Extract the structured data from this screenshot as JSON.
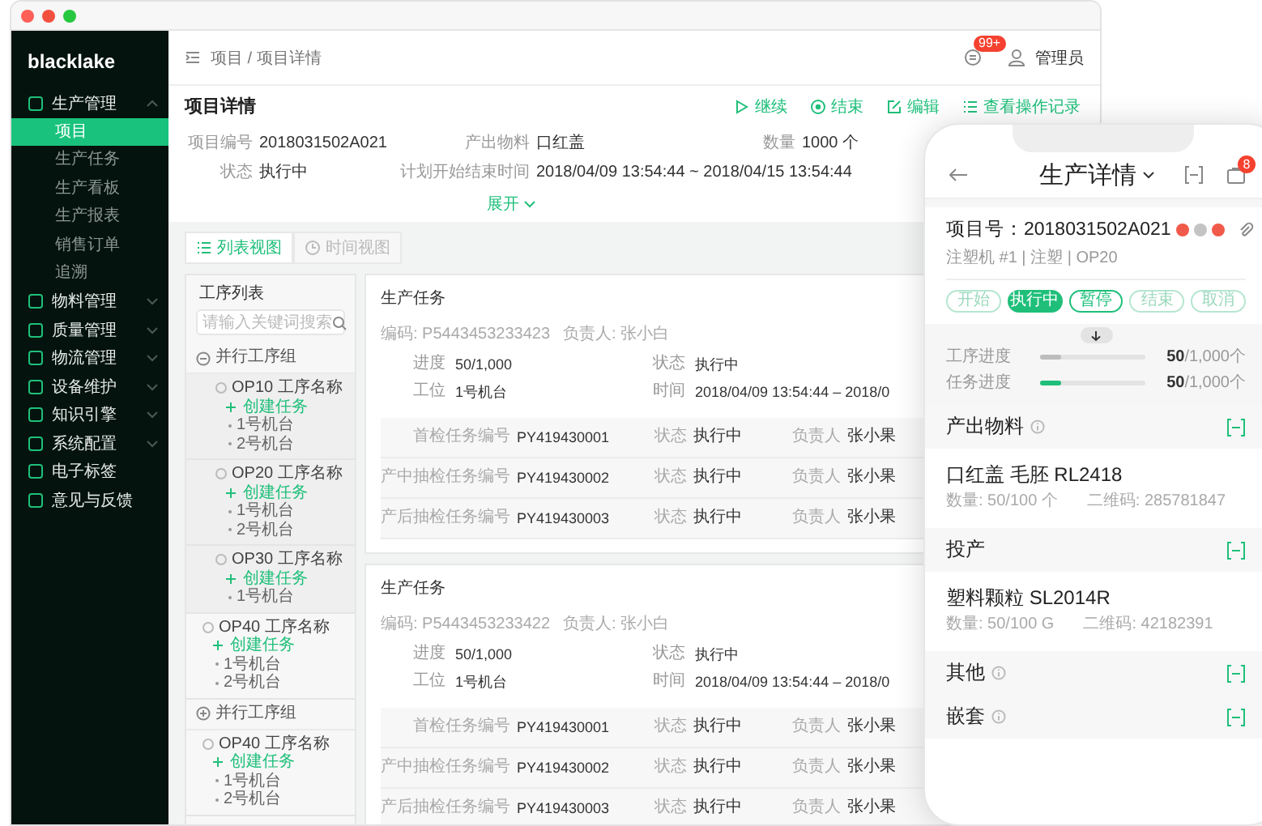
{
  "window": {
    "controls": [
      {
        "color": "#fe5f57"
      },
      {
        "color": "#f2503f"
      },
      {
        "color": "#27c840"
      }
    ]
  },
  "sidebar": {
    "logo": "blacklake",
    "items": [
      {
        "label": "生产管理",
        "kind": "group",
        "expanded": true,
        "children": [
          {
            "label": "项目",
            "selected": true
          },
          {
            "label": "生产任务",
            "selected": false
          },
          {
            "label": "生产看板",
            "selected": false
          },
          {
            "label": "生产报表",
            "selected": false
          },
          {
            "label": "销售订单",
            "selected": false
          },
          {
            "label": "追溯",
            "selected": false
          }
        ]
      },
      {
        "label": "物料管理",
        "kind": "group",
        "expanded": false
      },
      {
        "label": "质量管理",
        "kind": "group",
        "expanded": false
      },
      {
        "label": "物流管理",
        "kind": "group",
        "expanded": false
      },
      {
        "label": "设备维护",
        "kind": "group",
        "expanded": false
      },
      {
        "label": "知识引擎",
        "kind": "group",
        "expanded": false
      },
      {
        "label": "系统配置",
        "kind": "group",
        "expanded": false
      },
      {
        "label": "电子标签",
        "kind": "link"
      },
      {
        "label": "意见与反馈",
        "kind": "link"
      }
    ]
  },
  "header": {
    "breadcrumb": "项目 / 项目详情",
    "notification_badge": "99+",
    "user": "管理员"
  },
  "detail": {
    "title": "项目详情",
    "actions": [
      {
        "label": "继续"
      },
      {
        "label": "结束"
      },
      {
        "label": "编辑"
      },
      {
        "label": "查看操作记录"
      }
    ],
    "fields": [
      {
        "label": "项目编号",
        "value": "2018031502A021"
      },
      {
        "label": "产出物料",
        "value": "口红盖"
      },
      {
        "label": "数量",
        "value": "1000 个"
      },
      {
        "label": "状态",
        "value": "执行中"
      },
      {
        "label": "计划开始结束时间",
        "value": "2018/04/09 13:54:44 ~ 2018/04/15 13:54:44"
      }
    ],
    "expand": "展开"
  },
  "tabs": [
    {
      "label": "列表视图",
      "selected": true
    },
    {
      "label": "时间视图",
      "selected": false
    }
  ],
  "tree": {
    "title": "工序列表",
    "search_placeholder": "请输入关键词搜索",
    "items": [
      {
        "kind": "group",
        "label": "并行工序组",
        "expanded": true,
        "children": [
          {
            "kind": "process",
            "label": "OP10 工序名称",
            "action": "创建任务",
            "machines": [
              "1号机台",
              "2号机台"
            ]
          },
          {
            "kind": "process",
            "label": "OP20 工序名称",
            "action": "创建任务",
            "machines": [
              "1号机台",
              "2号机台"
            ]
          },
          {
            "kind": "process",
            "label": "OP30 工序名称",
            "action": "创建任务",
            "machines": [
              "1号机台"
            ]
          }
        ]
      },
      {
        "kind": "process",
        "label": "OP40 工序名称",
        "action": "创建任务",
        "machines": [
          "1号机台",
          "2号机台"
        ]
      },
      {
        "kind": "group",
        "label": "并行工序组",
        "expanded": false
      },
      {
        "kind": "process",
        "label": "OP40 工序名称",
        "action": "创建任务",
        "machines": [
          "1号机台",
          "2号机台"
        ]
      }
    ]
  },
  "tasks": [
    {
      "title": "生产任务",
      "code": "编码: P5443453233423",
      "owner": "负责人: 张小白",
      "fields": [
        {
          "label": "进度",
          "value": "50/1,000"
        },
        {
          "label": "状态",
          "value": "执行中"
        },
        {
          "label": "工位",
          "value": "1号机台"
        },
        {
          "label": "时间",
          "value": "2018/04/09 13:54:44 – 2018/0"
        }
      ],
      "checks": [
        {
          "label": "首检任务编号",
          "code": "PY419430001",
          "status_label": "状态",
          "status": "执行中",
          "owner_label": "负责人",
          "owner": "张小果"
        },
        {
          "label": "产中抽检任务编号",
          "code": "PY419430002",
          "status_label": "状态",
          "status": "执行中",
          "owner_label": "负责人",
          "owner": "张小果"
        },
        {
          "label": "产后抽检任务编号",
          "code": "PY419430003",
          "status_label": "状态",
          "status": "执行中",
          "owner_label": "负责人",
          "owner": "张小果"
        }
      ]
    },
    {
      "title": "生产任务",
      "code": "编码: P5443453233422",
      "owner": "负责人: 张小白",
      "fields": [
        {
          "label": "进度",
          "value": "50/1,000"
        },
        {
          "label": "状态",
          "value": "执行中"
        },
        {
          "label": "工位",
          "value": "1号机台"
        },
        {
          "label": "时间",
          "value": "2018/04/09 13:54:44 – 2018/0"
        }
      ],
      "checks": [
        {
          "label": "首检任务编号",
          "code": "PY419430001",
          "status_label": "状态",
          "status": "执行中",
          "owner_label": "负责人",
          "owner": "张小果"
        },
        {
          "label": "产中抽检任务编号",
          "code": "PY419430002",
          "status_label": "状态",
          "status": "执行中",
          "owner_label": "负责人",
          "owner": "张小果"
        },
        {
          "label": "产后抽检任务编号",
          "code": "PY419430003",
          "status_label": "状态",
          "status": "执行中",
          "owner_label": "负责人",
          "owner": "张小果"
        }
      ]
    }
  ],
  "phone": {
    "title": "生产详情",
    "cart_badge": "8",
    "project": "项目号：2018031502A021",
    "flags": [
      {
        "color": "#f05a4a"
      },
      {
        "color": "#c4c4c4"
      },
      {
        "color": "#f05a4a"
      }
    ],
    "subtitle": "注塑机 #1 | 注塑 | OP20",
    "statuses": [
      {
        "label": "开始",
        "selected": false,
        "disabled": true
      },
      {
        "label": "执行中",
        "selected": true,
        "disabled": false
      },
      {
        "label": "暂停",
        "selected": false,
        "disabled": false
      },
      {
        "label": "结束",
        "selected": false,
        "disabled": true
      },
      {
        "label": "取消",
        "selected": false,
        "disabled": true
      }
    ],
    "progress": [
      {
        "label": "工序进度",
        "level": 0.2,
        "color": "#bdbdbd",
        "reading": "**50**/1,000个"
      },
      {
        "label": "任务进度",
        "level": 0.2,
        "color": "#1fbf7a",
        "reading": "**50**/1,000个"
      }
    ],
    "sections": [
      {
        "title": "产出物料",
        "info": true,
        "items": [
          {
            "name": "口红盖 毛胚 RL2418",
            "quantity": "数量: 50/100 个",
            "code": "二维码: 285781847"
          }
        ]
      },
      {
        "title": "投产",
        "info": false,
        "items": [
          {
            "name": "塑料颗粒 SL2014R",
            "quantity": "数量: 50/100 G",
            "code": "二维码: 42182391"
          }
        ]
      },
      {
        "title": "其他",
        "info": true
      },
      {
        "title": "嵌套",
        "info": true
      }
    ]
  }
}
